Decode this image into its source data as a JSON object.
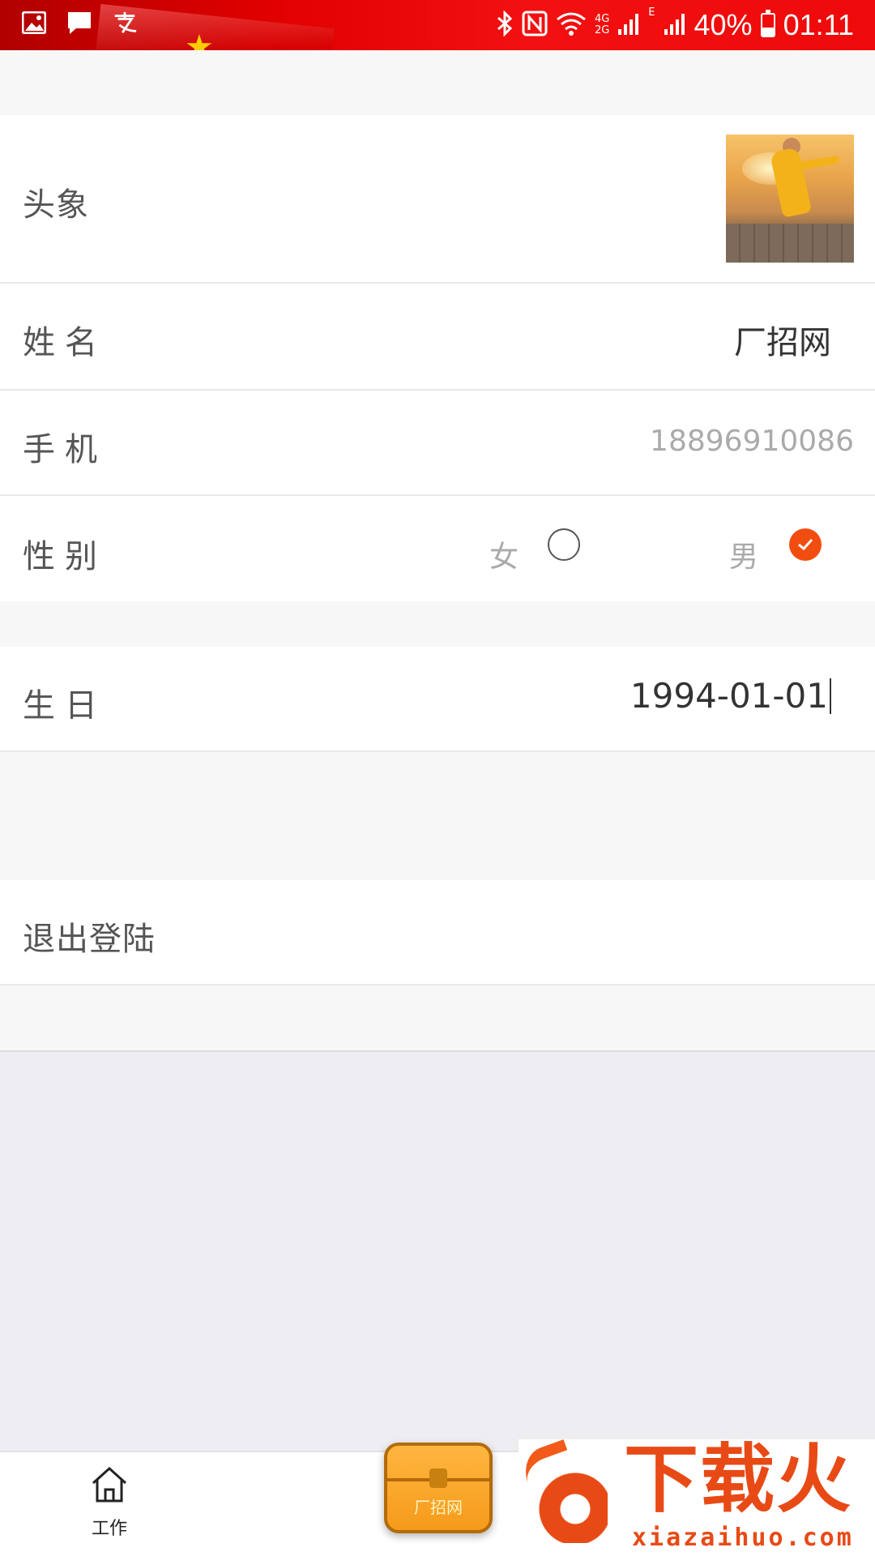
{
  "status_bar": {
    "battery": "40%",
    "time": "01:11",
    "network_top": "4G",
    "network_bottom": "2G",
    "network_e": "E",
    "left_icons": [
      "image-icon",
      "message-icon",
      "alipay-icon"
    ],
    "right_icons": [
      "bluetooth-icon",
      "nfc-icon",
      "wifi-icon",
      "signal-icon",
      "signal-icon",
      "battery-icon"
    ]
  },
  "profile": {
    "avatar_label": "头象",
    "name_label": "姓名",
    "name_value": "厂招网",
    "phone_label": "手机",
    "phone_value": "18896910086",
    "gender_label": "性别",
    "gender_options": [
      {
        "label": "女",
        "selected": false
      },
      {
        "label": "男",
        "selected": true
      }
    ],
    "birthday_label": "生日",
    "birthday_value": "1994-01-01",
    "logout_label": "退出登陆"
  },
  "tab_bar": {
    "work_label": "工作",
    "chest_text": "厂招网"
  },
  "watermark": {
    "main": "下载火",
    "sub": "xiazaihuo.com"
  },
  "colors": {
    "accent": "#f24d10",
    "status_bar": "#e60000",
    "page_band": "#f7f7f7",
    "empty_area": "#eeeef2"
  }
}
